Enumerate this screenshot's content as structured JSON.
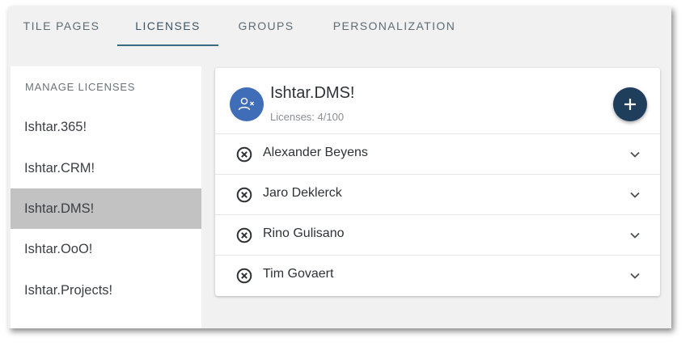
{
  "tabs": [
    {
      "label": "TILE PAGES",
      "active": false
    },
    {
      "label": "LICENSES",
      "active": true
    },
    {
      "label": "GROUPS",
      "active": false
    },
    {
      "label": "PERSONALIZATION",
      "active": false
    }
  ],
  "sidebar": {
    "heading": "MANAGE LICENSES",
    "items": [
      {
        "label": "Ishtar.365!",
        "selected": false
      },
      {
        "label": "Ishtar.CRM!",
        "selected": false
      },
      {
        "label": "Ishtar.DMS!",
        "selected": true
      },
      {
        "label": "Ishtar.OoO!",
        "selected": false
      },
      {
        "label": "Ishtar.Projects!",
        "selected": false
      }
    ]
  },
  "card": {
    "title": "Ishtar.DMS!",
    "subtitle": "Licenses: 4/100",
    "avatar_icon": "remove-user-icon",
    "add_icon": "plus-icon",
    "users": [
      {
        "name": "Alexander Beyens",
        "remove_icon": "remove-circle-icon",
        "expand_icon": "chevron-down-icon"
      },
      {
        "name": "Jaro Deklerck",
        "remove_icon": "remove-circle-icon",
        "expand_icon": "chevron-down-icon"
      },
      {
        "name": "Rino Gulisano",
        "remove_icon": "remove-circle-icon",
        "expand_icon": "chevron-down-icon"
      },
      {
        "name": "Tim Govaert",
        "remove_icon": "remove-circle-icon",
        "expand_icon": "chevron-down-icon"
      }
    ]
  },
  "colors": {
    "accent": "#3b6a85",
    "avatar": "#3f6db8",
    "fab": "#1e3e5c",
    "selected_bg": "#c2c2c2"
  }
}
